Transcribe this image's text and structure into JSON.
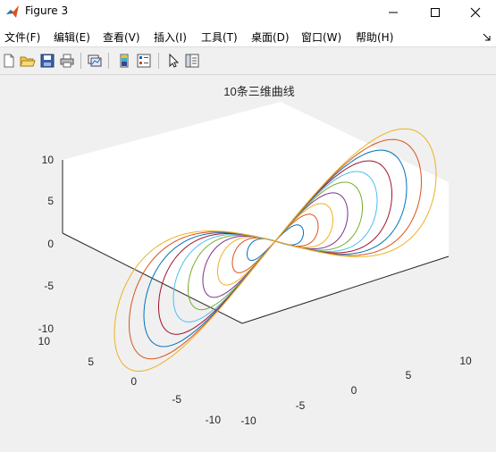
{
  "window": {
    "title": "Figure 3"
  },
  "menu": [
    {
      "label": "文件(F)"
    },
    {
      "label": "编辑(E)"
    },
    {
      "label": "查看(V)"
    },
    {
      "label": "插入(I)"
    },
    {
      "label": "工具(T)"
    },
    {
      "label": "桌面(D)"
    },
    {
      "label": "窗口(W)"
    },
    {
      "label": "帮助(H)"
    }
  ],
  "toolbar": [
    "new-figure-icon",
    "open-file-icon",
    "save-icon",
    "print-icon",
    "link-plot-icon",
    "insert-colorbar-icon",
    "insert-legend-icon",
    "edit-plot-icon",
    "property-inspector-icon"
  ],
  "chart_data": {
    "type": "line",
    "title": "10条三维曲线",
    "series_count": 10,
    "axes": {
      "z": {
        "range": [
          -10,
          10
        ],
        "ticks": [
          "10",
          "5",
          "0",
          "-5",
          "-10"
        ]
      },
      "y": {
        "range": [
          -10,
          10
        ],
        "ticks": [
          "10",
          "5",
          "0",
          "-5",
          "-10"
        ]
      },
      "x": {
        "range": [
          -10,
          10
        ],
        "ticks": [
          "-10",
          "-5",
          "0",
          "5",
          "10"
        ]
      }
    },
    "colors": [
      "#0072BD",
      "#D95319",
      "#EDB120",
      "#7E2F8E",
      "#77AC30",
      "#4DBEEE",
      "#A2142F"
    ],
    "grid": false
  }
}
